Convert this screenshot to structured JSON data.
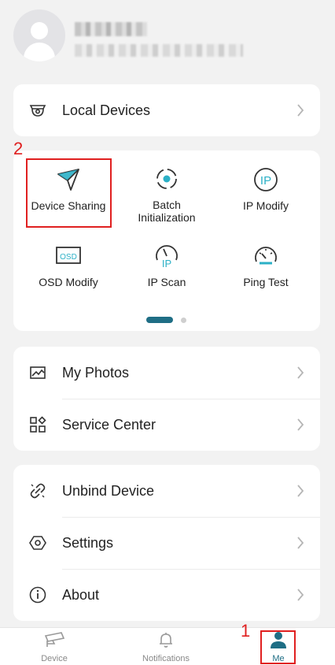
{
  "colors": {
    "accent": "#1f6e85",
    "icon_teal": "#2bb0c6",
    "annotation_red": "#e02020"
  },
  "devices_card": {
    "label": "Local Devices",
    "icon": "camera-icon"
  },
  "tools": [
    {
      "label": "Device Sharing",
      "icon": "paper-plane-icon"
    },
    {
      "label": "Batch\nInitialization",
      "icon": "batch-init-icon"
    },
    {
      "label": "IP Modify",
      "icon": "ip-icon",
      "glyph": "IP"
    },
    {
      "label": "OSD Modify",
      "icon": "osd-icon",
      "glyph": "OSD"
    },
    {
      "label": "IP Scan",
      "icon": "ip-scan-icon",
      "glyph": "IP"
    },
    {
      "label": "Ping Test",
      "icon": "speedometer-icon"
    }
  ],
  "pager": {
    "pages": 2,
    "current": 1
  },
  "menu_card_1": [
    {
      "label": "My Photos",
      "icon": "photo-icon"
    },
    {
      "label": "Service Center",
      "icon": "apps-icon"
    }
  ],
  "menu_card_2": [
    {
      "label": "Unbind Device",
      "icon": "unlink-icon"
    },
    {
      "label": "Settings",
      "icon": "settings-icon"
    },
    {
      "label": "About",
      "icon": "info-icon"
    }
  ],
  "annotations": {
    "step1": "1",
    "step2": "2"
  },
  "nav": [
    {
      "label": "Device",
      "icon": "cctv-icon"
    },
    {
      "label": "Notifications",
      "icon": "bell-icon"
    },
    {
      "label": "Me",
      "icon": "person-icon",
      "active": true
    }
  ]
}
